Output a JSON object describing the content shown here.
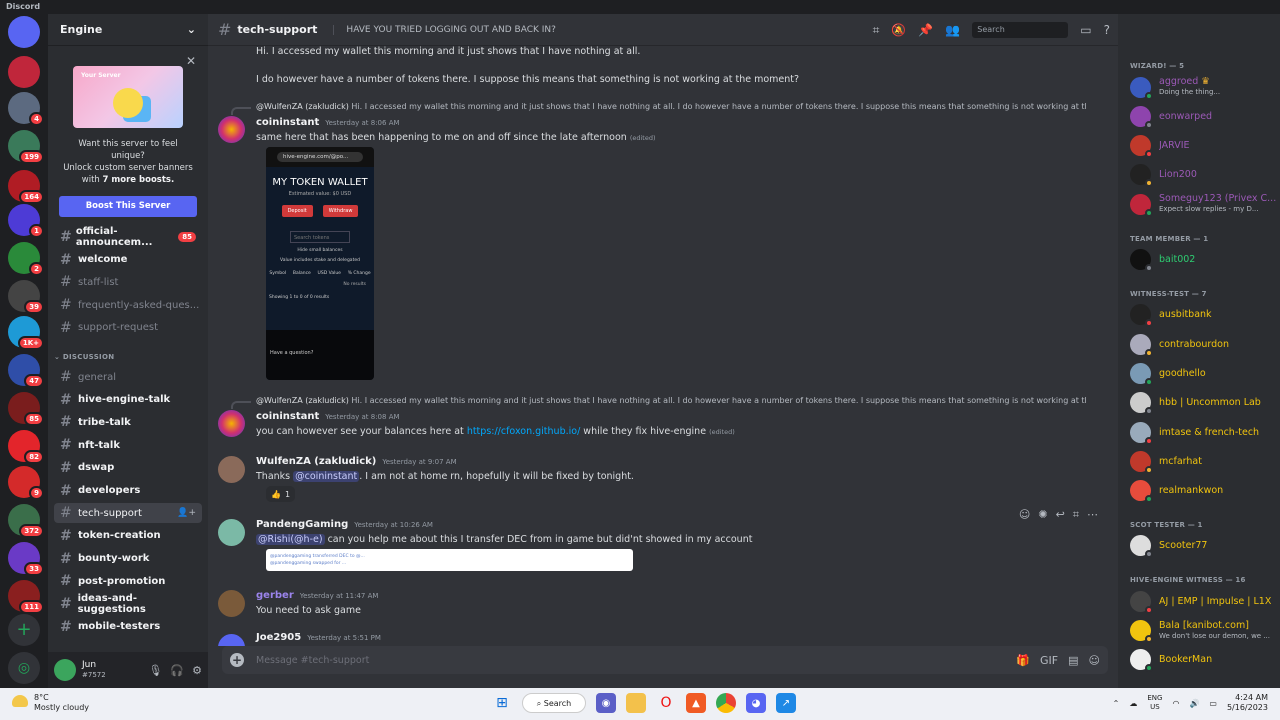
{
  "app": {
    "title": "Discord"
  },
  "servers": [
    {
      "name": "home",
      "color": "#5865f2",
      "badge": ""
    },
    {
      "name": "GLS",
      "color": "#c0263b",
      "badge": ""
    },
    {
      "name": "server-2",
      "color": "#5c6a80",
      "badge": "4"
    },
    {
      "name": "server-3",
      "color": "#3a7a5a",
      "badge": "199"
    },
    {
      "name": "server-4",
      "color": "#b01c24",
      "badge": "164"
    },
    {
      "name": "server-5",
      "color": "#4d3bd6",
      "badge": "1"
    },
    {
      "name": "server-6",
      "color": "#2a8a3a",
      "badge": "2"
    },
    {
      "name": "server-7",
      "color": "#444",
      "badge": "39"
    },
    {
      "name": "server-8",
      "color": "#1e9ad6",
      "badge": "1K+"
    },
    {
      "name": "server-9",
      "color": "#2f4ea8",
      "badge": "47"
    },
    {
      "name": "server-10",
      "color": "#7a1d1d",
      "badge": "85"
    },
    {
      "name": "server-11",
      "color": "#e3252b",
      "badge": "82"
    },
    {
      "name": "server-12",
      "color": "#d42a2a",
      "badge": "9"
    },
    {
      "name": "server-13",
      "color": "#3a6e4a",
      "badge": "372"
    },
    {
      "name": "server-14",
      "color": "#6a3ac6",
      "badge": "33"
    },
    {
      "name": "server-15",
      "color": "#8a1f1f",
      "badge": "111"
    }
  ],
  "sidebar": {
    "server_name": "Engine",
    "boost": {
      "art_title": "Your Server",
      "text_line1": "Want this server to feel unique?",
      "text_line2": "Unlock custom server banners",
      "text_line3_pre": "with ",
      "text_line3_bold": "7 more boosts.",
      "button": "Boost This Server"
    },
    "channels": [
      {
        "name": "official-announcem...",
        "state": "unread",
        "badge": "85"
      },
      {
        "name": "welcome",
        "state": "unread",
        "badge": ""
      },
      {
        "name": "staff-list",
        "state": "muted",
        "badge": ""
      },
      {
        "name": "frequently-asked-ques...",
        "state": "muted",
        "badge": ""
      },
      {
        "name": "support-request",
        "state": "muted",
        "badge": ""
      }
    ],
    "category": "DISCUSSION",
    "discussion_channels": [
      {
        "name": "general",
        "state": "muted"
      },
      {
        "name": "hive-engine-talk",
        "state": "unread"
      },
      {
        "name": "tribe-talk",
        "state": "unread"
      },
      {
        "name": "nft-talk",
        "state": "unread"
      },
      {
        "name": "dswap",
        "state": "unread"
      },
      {
        "name": "developers",
        "state": "unread"
      },
      {
        "name": "tech-support",
        "state": "active"
      },
      {
        "name": "token-creation",
        "state": "unread"
      },
      {
        "name": "bounty-work",
        "state": "unread"
      },
      {
        "name": "post-promotion",
        "state": "unread"
      },
      {
        "name": "ideas-and-suggestions",
        "state": "unread"
      },
      {
        "name": "mobile-testers",
        "state": "unread"
      }
    ],
    "user": {
      "name": "Jun",
      "tag": "#7572"
    }
  },
  "channel": {
    "name": "tech-support",
    "topic": "HAVE YOU TRIED LOGGING OUT AND BACK IN?"
  },
  "search": {
    "placeholder": "Search"
  },
  "messages": {
    "m0_line1": "Hi. I accessed my wallet this morning and it just shows that I have nothing at all.",
    "m0_line2": "I do however have a number of tokens there. I suppose this means that something is not working at the moment?",
    "reply_author": "@WulfenZA (zakludick)",
    "reply_text": " Hi. I accessed my wallet this morning and it just shows that I have nothing at all. I do however have a number of tokens there. I suppose this means that something is not working at the moment?",
    "m1_author": "coininstant",
    "m1_time": "Yesterday at 8:06 AM",
    "m1_text": "same here that has been happening to me on and off since the late afternoon",
    "edited": "(edited)",
    "wallet": {
      "url": "hive-engine.com/@po...",
      "title": "MY TOKEN WALLET",
      "est": "Estimated value: $0 USD",
      "deposit": "Deposit",
      "withdraw": "Withdraw",
      "search": "Search tokens",
      "opt1": "Hide small balances",
      "opt2": "Value includes stake and delegated",
      "col1": "Symbol",
      "col2": "Balance",
      "col3": "USD Value",
      "col4": "% Change",
      "nores": "No results",
      "showing": "Showing 1 to 0 of 0 results",
      "foot": "Have a question?"
    },
    "m2_author": "coininstant",
    "m2_time": "Yesterday at 8:08 AM",
    "m2_pre": "you can however see your balances here at ",
    "m2_link": "https://cfoxon.github.io/",
    "m2_post": " while they fix hive-engine",
    "m3_author": "WulfenZA (zakludick)",
    "m3_time": "Yesterday at 9:07 AM",
    "m3_pre": "Thanks ",
    "m3_mention": "@coininstant",
    "m3_post": ". I am not at home rn, hopefully it will be fixed by tonight.",
    "m3_reaction": "1",
    "m4_author": "PandengGaming",
    "m4_time": "Yesterday at 10:26 AM",
    "m4_mention": "@Rishi(@h-e)",
    "m4_text": " can you help me about this I transfer DEC from in game but did'nt showed in my account",
    "m4_img_line1": "@pandenggaming transferred DEC to @...",
    "m4_img_line2": "@pandenggaming swapped for ...",
    "m5_author": "gerber",
    "m5_time": "Yesterday at 11:47 AM",
    "m5_text": "You need to ask game",
    "m6_author": "Joe2905",
    "m6_time": "Yesterday at 5:51 PM"
  },
  "composer": {
    "placeholder": "Message #tech-support"
  },
  "members": {
    "groups": [
      {
        "title": "WIZARD! — 5",
        "items": [
          {
            "name": "aggroed",
            "status_text": "Doing the thing...",
            "color": "#9b59b6",
            "crown": "♛"
          },
          {
            "name": "eonwarped",
            "status_text": "",
            "color": "#9b59b6",
            "crown": ""
          },
          {
            "name": "JARVIE",
            "status_text": "",
            "color": "#9b59b6",
            "crown": ""
          },
          {
            "name": "Lion200",
            "status_text": "",
            "color": "#9b59b6",
            "crown": ""
          },
          {
            "name": "Someguy123 (Privex C...",
            "status_text": "Expect slow replies - my D...",
            "color": "#9b59b6",
            "crown": ""
          }
        ]
      },
      {
        "title": "TEAM MEMBER — 1",
        "items": [
          {
            "name": "bait002",
            "status_text": "",
            "color": "#2ecc71",
            "crown": ""
          }
        ]
      },
      {
        "title": "WITNESS-TEST — 7",
        "items": [
          {
            "name": "ausbitbank",
            "status_text": "",
            "color": "#f1c40f",
            "crown": ""
          },
          {
            "name": "contrabourdon",
            "status_text": "",
            "color": "#f1c40f",
            "crown": ""
          },
          {
            "name": "goodhello",
            "status_text": "",
            "color": "#f1c40f",
            "crown": ""
          },
          {
            "name": "hbb | Uncommon Lab",
            "status_text": "",
            "color": "#f1c40f",
            "crown": ""
          },
          {
            "name": "imtase & french-tech",
            "status_text": "",
            "color": "#f1c40f",
            "crown": ""
          },
          {
            "name": "mcfarhat",
            "status_text": "",
            "color": "#f1c40f",
            "crown": ""
          },
          {
            "name": "realmankwon",
            "status_text": "",
            "color": "#f1c40f",
            "crown": ""
          }
        ]
      },
      {
        "title": "SCOT TESTER — 1",
        "items": [
          {
            "name": "Scooter77",
            "status_text": "",
            "color": "#f1c40f",
            "crown": ""
          }
        ]
      },
      {
        "title": "HIVE-ENGINE WITNESS — 16",
        "items": [
          {
            "name": "AJ | EMP | Impulse | L1X",
            "status_text": "",
            "color": "#f1c40f",
            "crown": ""
          },
          {
            "name": "Bala [kanibot.com]",
            "status_text": "We don't lose our demon, we ...",
            "color": "#f1c40f",
            "crown": ""
          },
          {
            "name": "BookerMan",
            "status_text": "",
            "color": "#f1c40f",
            "crown": ""
          }
        ]
      }
    ]
  },
  "taskbar": {
    "temp": "8°C",
    "weather": "Mostly cloudy",
    "search": "Search",
    "lang1": "ENG",
    "lang2": "US",
    "time": "4:24 AM",
    "date": "5/16/2023"
  }
}
